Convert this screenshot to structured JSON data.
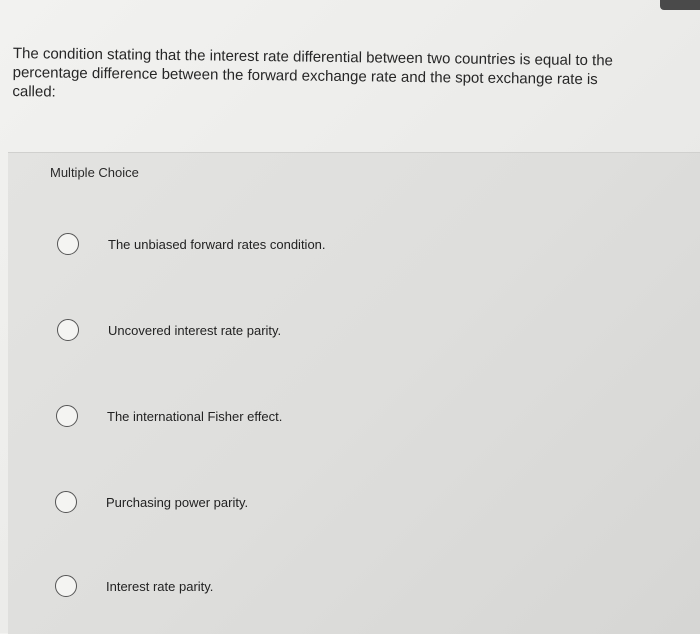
{
  "question": {
    "text": "The condition stating that the interest rate differential between two countries is equal to the percentage difference between the forward exchange rate and the spot exchange rate is called:"
  },
  "choices": {
    "label": "Multiple Choice",
    "options": [
      {
        "label": "The unbiased forward rates condition."
      },
      {
        "label": "Uncovered interest rate parity."
      },
      {
        "label": "The international Fisher effect."
      },
      {
        "label": "Purchasing power parity."
      },
      {
        "label": "Interest rate parity."
      }
    ]
  }
}
